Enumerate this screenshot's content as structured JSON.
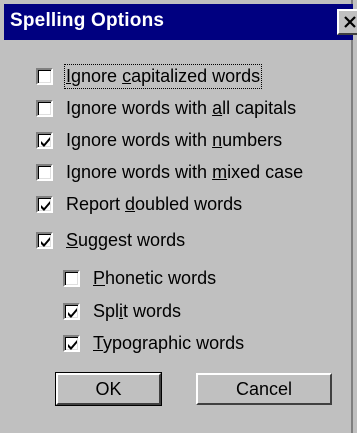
{
  "window": {
    "title": "Spelling Options",
    "close_label": "X"
  },
  "options": [
    {
      "label": "Ignore capitalized words",
      "checked": false
    },
    {
      "label": "Ignore words with all capitals",
      "checked": false
    },
    {
      "label": "Ignore words with numbers",
      "checked": true
    },
    {
      "label": "Ignore words with mixed case",
      "checked": false
    },
    {
      "label": "Report doubled words",
      "checked": true
    },
    {
      "label": "Suggest words",
      "checked": true
    }
  ],
  "suggest_options": [
    {
      "label": "Phonetic words",
      "checked": false
    },
    {
      "label": "Split words",
      "checked": true
    },
    {
      "label": "Typographic words",
      "checked": true
    }
  ],
  "buttons": {
    "ok": "OK",
    "cancel": "Cancel"
  }
}
